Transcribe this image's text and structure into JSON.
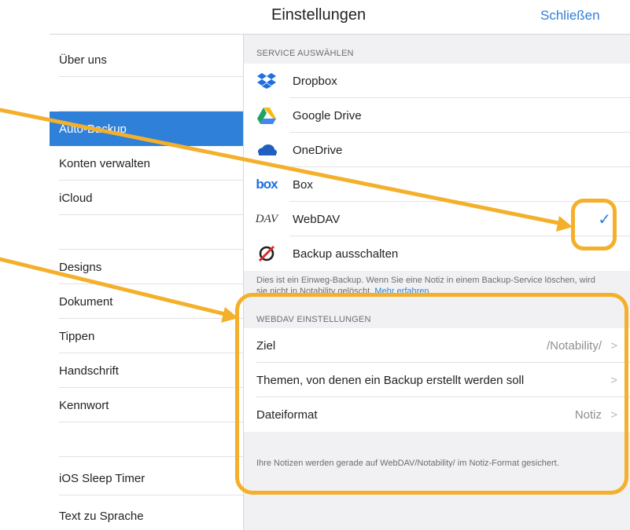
{
  "header": {
    "title": "Einstellungen",
    "close_label": "Schließen"
  },
  "sidebar": {
    "items": [
      {
        "label": "Über uns"
      },
      {
        "label": ""
      },
      {
        "label": "Auto-Backup"
      },
      {
        "label": "Konten verwalten"
      },
      {
        "label": "iCloud"
      },
      {
        "label": ""
      },
      {
        "label": "Designs"
      },
      {
        "label": "Dokument"
      },
      {
        "label": "Tippen"
      },
      {
        "label": "Handschrift"
      },
      {
        "label": "Kennwort"
      },
      {
        "label": ""
      },
      {
        "label": "iOS Sleep Timer"
      },
      {
        "label": "Text zu Sprache"
      }
    ],
    "active_index": 2
  },
  "service": {
    "header": "SERVICE AUSWÄHLEN",
    "items": [
      {
        "label": "Dropbox",
        "icon": "dropbox-icon"
      },
      {
        "label": "Google Drive",
        "icon": "google-drive-icon"
      },
      {
        "label": "OneDrive",
        "icon": "onedrive-icon"
      },
      {
        "label": "Box",
        "icon": "box-icon",
        "icon_text": "box"
      },
      {
        "label": "WebDAV",
        "icon": "webdav-icon",
        "icon_text": "DAV",
        "checkmark": "✓"
      },
      {
        "label": "Backup ausschalten",
        "icon": "backup-off-icon"
      }
    ],
    "footnote": "Dies ist ein Einweg-Backup. Wenn Sie eine Notiz in einem Backup-Service löschen, wird sie nicht in Notability gelöscht.",
    "footnote_link": "Mehr erfahren"
  },
  "webdav": {
    "header": "WEBDAV EINSTELLUNGEN",
    "rows": [
      {
        "label": "Ziel",
        "value": "/Notability/",
        "chevron": ">"
      },
      {
        "label": "Themen, von denen ein Backup erstellt werden soll",
        "value": "",
        "chevron": ">"
      },
      {
        "label": "Dateiformat",
        "value": "Notiz",
        "chevron": ">"
      }
    ],
    "footnote": "Ihre Notizen werden gerade auf WebDAV/Notability/ im Notiz-Format gesichert."
  },
  "colors": {
    "accent": "#2f80d8",
    "annotation": "#f4b02b",
    "dropbox": "#1f6fe0",
    "onedrive": "#1e5fbf",
    "backup_off": "#d92b2b"
  }
}
